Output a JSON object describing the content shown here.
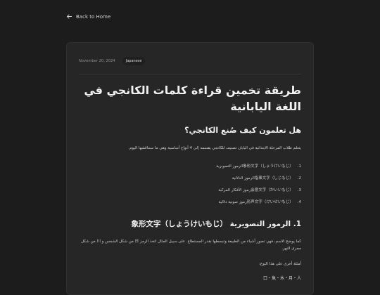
{
  "nav": {
    "back_label": "Back to Home"
  },
  "article": {
    "date": "November 20, 2024",
    "tag": "Japanese",
    "title": "طريقة تخمين قراءة كلمات الكانجي في اللغة اليابانية",
    "section_heading": "هل تعلمون كيف صُنع الكانجي؟",
    "intro": "يتعلم طلاب المرحلة الابتدائية في اليابان تصنيف للكانجي يقسمه إلى 4 أنواع أساسية وهي ما سنناقشها اليوم.",
    "list": [
      {
        "num": "1.",
        "text": "象形文字（しょうけいもじ）الرموز التصويرية"
      },
      {
        "num": "2.",
        "text": "指事文字（しじもじ）الرموز الدلالية"
      },
      {
        "num": "3.",
        "text": "会意文字（かいいもじ）رموز الأفكار المركبة"
      },
      {
        "num": "4.",
        "text": "形声文字（けいせいもじ）رموز صوتية دلالية"
      }
    ],
    "subsection_heading": "1. الرموز التصويرية 象形文字（しょうけいもじ）",
    "paragraph": "كما يوضح الاسم، فهي تصور أشياء من الطبيعة وتبسطها بقدر المستطاع. على سبيل المثال اتخذ الرمز 日 من شكل الشمس و 川 من شكل مجرى النهر.",
    "examples_label": "أمثلة أخرى على هذا النوع:",
    "examples_kanji": "口・魚・木・月・人"
  }
}
